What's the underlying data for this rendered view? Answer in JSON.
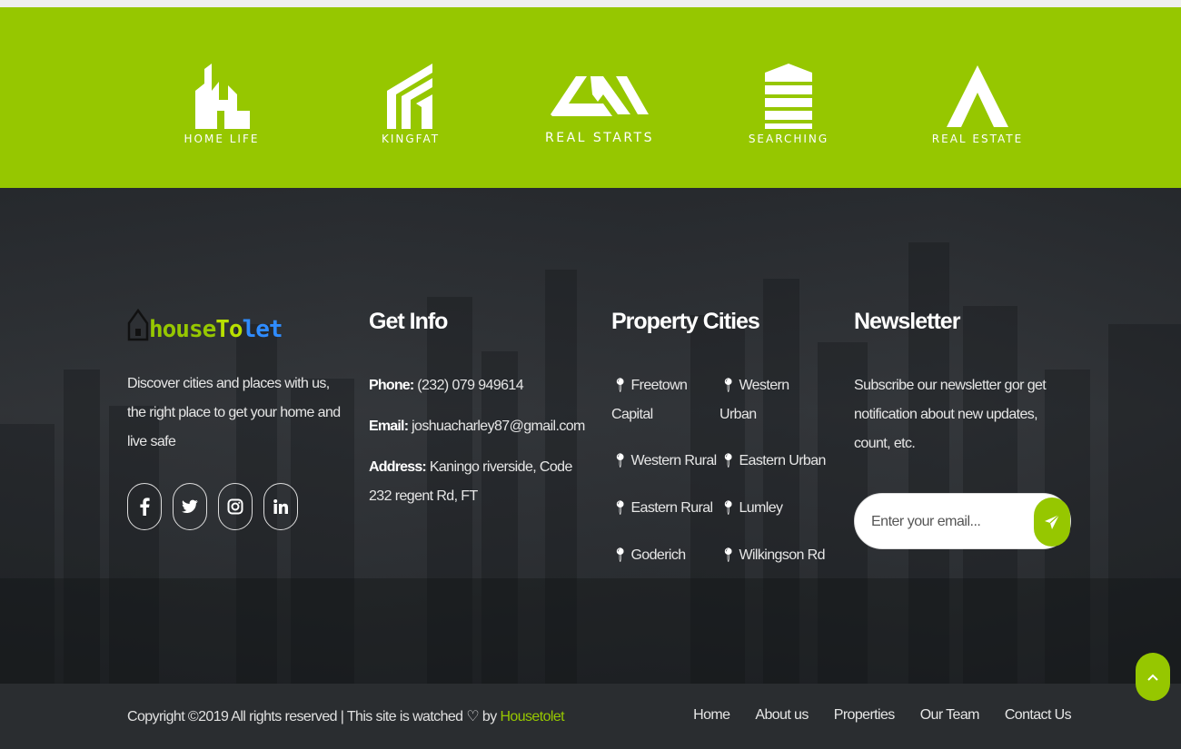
{
  "partners": [
    {
      "label": "HOME LIFE",
      "icon": "building-logo-icon"
    },
    {
      "label": "KINGFAT",
      "icon": "house-stripes-logo-icon"
    },
    {
      "label": "REAL STARTS",
      "icon": "roof-peaks-logo-icon"
    },
    {
      "label": "SEARCHING",
      "icon": "stacked-blocks-logo-icon"
    },
    {
      "label": "REAL ESTATE",
      "icon": "triangle-a-logo-icon"
    }
  ],
  "brand": {
    "house": "house",
    "to": "To",
    "let": "let"
  },
  "about": {
    "text": "Discover cities and places with us, the right place to get your home and live safe"
  },
  "socials": [
    {
      "name": "facebook-icon",
      "glyph": "f"
    },
    {
      "name": "twitter-icon",
      "glyph": "t"
    },
    {
      "name": "instagram-icon",
      "glyph": "ig"
    },
    {
      "name": "linkedin-icon",
      "glyph": "in"
    }
  ],
  "info": {
    "title": "Get Info",
    "phone_label": "Phone:",
    "phone": "(232) 079 949614",
    "email_label": "Email:",
    "email": "joshuacharley87@gmail.com",
    "address_label": "Address:",
    "address": "Kaningo riverside, Code 232 regent Rd, FT"
  },
  "cities": {
    "title": "Property Cities",
    "items": [
      "Freetown Capital",
      "Western Urban",
      "Western Rural",
      "Eastern Urban",
      "Eastern Rural",
      "Lumley",
      "Goderich",
      "Wilkingson Rd"
    ]
  },
  "newsletter": {
    "title": "Newsletter",
    "text": "Subscribe our newsletter gor get notification about new updates, count, etc.",
    "placeholder": "Enter your email..."
  },
  "footer": {
    "copyright_prefix": "Copyright ©2019 All rights reserved | This site is watched ♡ by ",
    "brand_link": "Housetolet",
    "nav": [
      "Home",
      "About us",
      "Properties",
      "Our Team",
      "Contact Us"
    ]
  },
  "colors": {
    "accent": "#96c700",
    "let_blue": "#2f8cff",
    "footer_bg": "#2a2d30"
  }
}
